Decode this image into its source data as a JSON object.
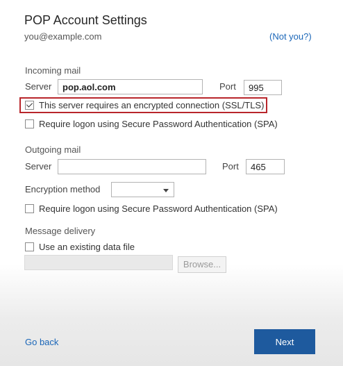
{
  "header": {
    "title": "POP Account Settings",
    "email": "you@example.com",
    "not_you_link": "(Not you?)"
  },
  "incoming": {
    "section_label": "Incoming mail",
    "server_label": "Server",
    "server_value": "pop.aol.com",
    "port_label": "Port",
    "port_value": "995",
    "ssl_checkbox_label": "This server requires an encrypted connection (SSL/TLS)",
    "ssl_checked": true,
    "spa_checkbox_label": "Require logon using Secure Password Authentication (SPA)",
    "spa_checked": false
  },
  "outgoing": {
    "section_label": "Outgoing mail",
    "server_label": "Server",
    "server_value": "",
    "port_label": "Port",
    "port_value": "465",
    "encryption_label": "Encryption method",
    "encryption_value": "",
    "spa_checkbox_label": "Require logon using Secure Password Authentication (SPA)",
    "spa_checked": false
  },
  "delivery": {
    "section_label": "Message delivery",
    "existing_file_label": "Use an existing data file",
    "existing_file_checked": false,
    "file_path_value": "",
    "browse_label": "Browse..."
  },
  "footer": {
    "go_back_label": "Go back",
    "next_label": "Next"
  },
  "colors": {
    "accent": "#1e5a9e",
    "link": "#1a66b8",
    "highlight_border": "#b8262b"
  }
}
